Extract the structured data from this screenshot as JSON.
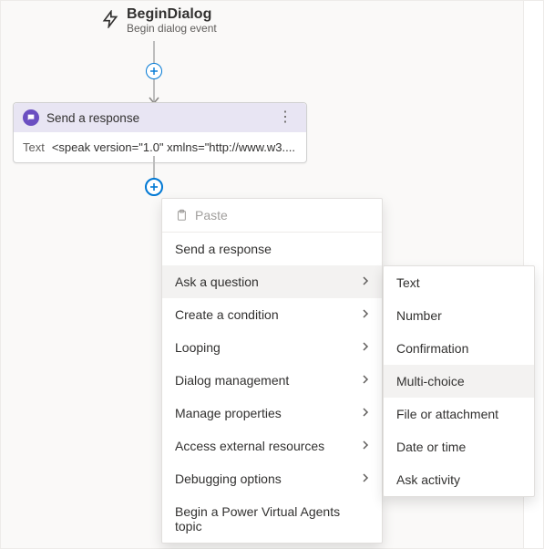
{
  "trigger": {
    "title": "BeginDialog",
    "subtitle": "Begin dialog event"
  },
  "responseCard": {
    "title": "Send a response",
    "textLabel": "Text",
    "textValue": "<speak version=\"1.0\" xmlns=\"http://www.w3...."
  },
  "menu": {
    "paste": "Paste",
    "items": [
      {
        "label": "Send a response",
        "hasSubmenu": false
      },
      {
        "label": "Ask a question",
        "hasSubmenu": true,
        "active": true
      },
      {
        "label": "Create a condition",
        "hasSubmenu": true
      },
      {
        "label": "Looping",
        "hasSubmenu": true
      },
      {
        "label": "Dialog management",
        "hasSubmenu": true
      },
      {
        "label": "Manage properties",
        "hasSubmenu": true
      },
      {
        "label": "Access external resources",
        "hasSubmenu": true
      },
      {
        "label": "Debugging options",
        "hasSubmenu": true
      },
      {
        "label": "Begin a Power Virtual Agents topic",
        "hasSubmenu": false
      }
    ]
  },
  "submenu": {
    "items": [
      {
        "label": "Text"
      },
      {
        "label": "Number"
      },
      {
        "label": "Confirmation"
      },
      {
        "label": "Multi-choice",
        "hover": true
      },
      {
        "label": "File or attachment"
      },
      {
        "label": "Date or time"
      },
      {
        "label": "Ask activity"
      }
    ]
  }
}
